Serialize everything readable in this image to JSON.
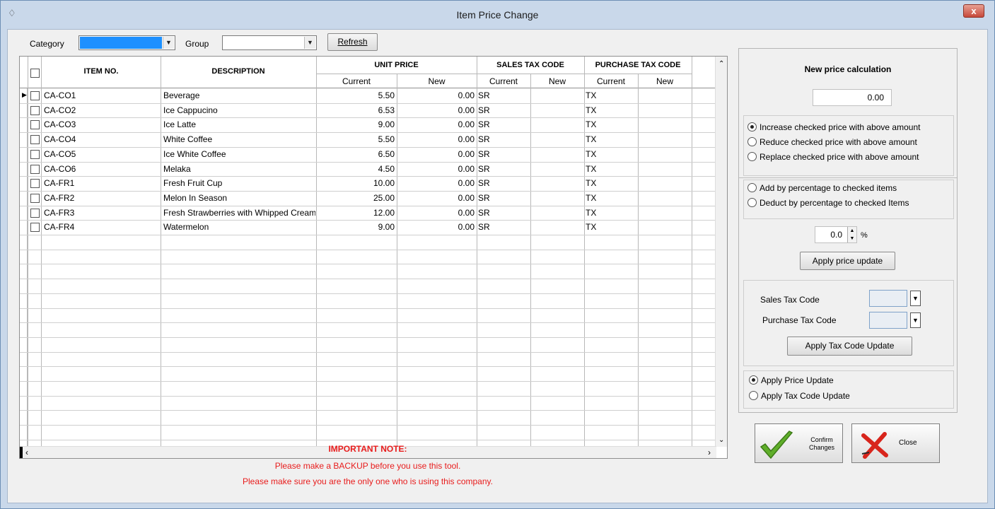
{
  "window": {
    "title": "Item Price Change",
    "close_glyph": "x"
  },
  "filters": {
    "category_label": "Category",
    "group_label": "Group",
    "refresh_label": "Refresh"
  },
  "grid": {
    "headers": {
      "item_no": "ITEM NO.",
      "description": "DESCRIPTION",
      "unit_price": "UNIT PRICE",
      "sales_tax_code": "SALES TAX CODE",
      "purchase_tax_code": "PURCHASE TAX CODE",
      "current": "Current",
      "new": "New"
    },
    "rows": [
      {
        "item_no": "CA-CO1",
        "description": "Beverage",
        "price_current": "5.50",
        "price_new": "0.00",
        "sales_current": "SR",
        "purchase_current": "TX"
      },
      {
        "item_no": "CA-CO2",
        "description": "Ice Cappucino",
        "price_current": "6.53",
        "price_new": "0.00",
        "sales_current": "SR",
        "purchase_current": "TX"
      },
      {
        "item_no": "CA-CO3",
        "description": "Ice Latte",
        "price_current": "9.00",
        "price_new": "0.00",
        "sales_current": "SR",
        "purchase_current": "TX"
      },
      {
        "item_no": "CA-CO4",
        "description": "White Coffee",
        "price_current": "5.50",
        "price_new": "0.00",
        "sales_current": "SR",
        "purchase_current": "TX"
      },
      {
        "item_no": "CA-CO5",
        "description": "Ice White Coffee",
        "price_current": "6.50",
        "price_new": "0.00",
        "sales_current": "SR",
        "purchase_current": "TX"
      },
      {
        "item_no": "CA-CO6",
        "description": "Melaka",
        "price_current": "4.50",
        "price_new": "0.00",
        "sales_current": "SR",
        "purchase_current": "TX"
      },
      {
        "item_no": "CA-FR1",
        "description": "Fresh Fruit Cup",
        "price_current": "10.00",
        "price_new": "0.00",
        "sales_current": "SR",
        "purchase_current": "TX"
      },
      {
        "item_no": "CA-FR2",
        "description": "Melon In Season",
        "price_current": "25.00",
        "price_new": "0.00",
        "sales_current": "SR",
        "purchase_current": "TX"
      },
      {
        "item_no": "CA-FR3",
        "description": "Fresh Strawberries with Whipped Cream",
        "price_current": "12.00",
        "price_new": "0.00",
        "sales_current": "SR",
        "purchase_current": "TX"
      },
      {
        "item_no": "CA-FR4",
        "description": "Watermelon",
        "price_current": "9.00",
        "price_new": "0.00",
        "sales_current": "SR",
        "purchase_current": "TX"
      }
    ]
  },
  "calc": {
    "title": "New price calculation",
    "amount": "0.00",
    "opt_increase": "Increase checked price with above amount",
    "opt_reduce": "Reduce checked price with above amount",
    "opt_replace": "Replace checked price with above amount",
    "opt_add_pct": "Add by percentage to checked items",
    "opt_deduct_pct": "Deduct by percentage to checked Items",
    "percent_value": "0.0",
    "percent_sign": "%",
    "apply_price_label": "Apply price update",
    "sales_tax_label": "Sales Tax Code",
    "purchase_tax_label": "Purchase Tax Code",
    "apply_tax_label": "Apply Tax Code Update",
    "mode_price": "Apply Price Update",
    "mode_tax": "Apply Tax Code Update"
  },
  "note": {
    "title": "IMPORTANT NOTE:",
    "line1": "Please make a BACKUP before you use this tool.",
    "line2": "Please make sure you are the only one  who is using  this company."
  },
  "actions": {
    "confirm_line1": "Confirm",
    "confirm_line2": "Changes",
    "close_label": "Close"
  }
}
